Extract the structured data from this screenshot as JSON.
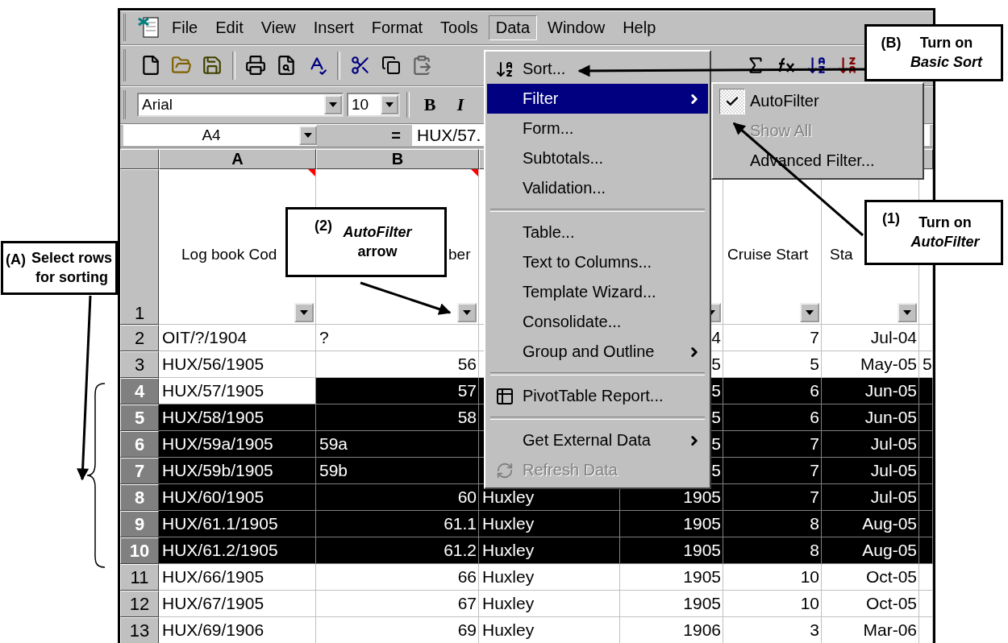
{
  "menubar": {
    "items": [
      {
        "label": "File",
        "selected": false
      },
      {
        "label": "Edit",
        "selected": false
      },
      {
        "label": "View",
        "selected": false
      },
      {
        "label": "Insert",
        "selected": false
      },
      {
        "label": "Format",
        "selected": false
      },
      {
        "label": "Tools",
        "selected": false
      },
      {
        "label": "Data",
        "selected": true
      },
      {
        "label": "Window",
        "selected": false
      },
      {
        "label": "Help",
        "selected": false
      }
    ]
  },
  "formatting_toolbar": {
    "font": "Arial",
    "size": "10",
    "bold_button": "B",
    "italic_button": "I"
  },
  "formula_bar": {
    "name_box": "A4",
    "equals": "=",
    "value": "HUX/57."
  },
  "columns": [
    {
      "label": "A"
    },
    {
      "label": "B"
    },
    {},
    {},
    {},
    {},
    {}
  ],
  "header_row": {
    "number": "1",
    "cells": [
      {
        "text": "Log book Cod",
        "filter": true,
        "comment": true
      },
      {
        "text": "ber",
        "filter": true,
        "comment": true
      },
      {
        "filter": false,
        "comment": false
      },
      {
        "filter": true,
        "comment": false
      },
      {
        "text": "Cruise Start",
        "filter": true,
        "comment": false
      },
      {
        "text": "Sta",
        "filter": true,
        "comment": false
      },
      {
        "filter": false,
        "comment": false
      }
    ]
  },
  "rows": [
    {
      "number": "2",
      "selected": false,
      "cells": [
        {
          "text": "OIT/?/1904",
          "kind": "text",
          "active": false
        },
        {
          "text": "?",
          "kind": "text",
          "active": false
        },
        {
          "active": false
        },
        {
          "text": "4",
          "kind": "number",
          "active": false
        },
        {
          "text": "7",
          "kind": "number",
          "active": false
        },
        {
          "text": "Jul-04",
          "kind": "number",
          "active": false
        },
        {
          "active": false
        }
      ]
    },
    {
      "number": "3",
      "selected": false,
      "cells": [
        {
          "text": "HUX/56/1905",
          "kind": "text",
          "active": false
        },
        {
          "text": "56",
          "kind": "number",
          "active": false
        },
        {
          "active": false
        },
        {
          "text": "5",
          "kind": "number",
          "active": false
        },
        {
          "text": "5",
          "kind": "number",
          "active": false
        },
        {
          "text": "May-05",
          "kind": "number",
          "active": false
        },
        {
          "text": "5",
          "kind": "text",
          "active": false
        }
      ]
    },
    {
      "number": "4",
      "selected": true,
      "cells": [
        {
          "text": "HUX/57/1905",
          "kind": "text",
          "active": true
        },
        {
          "text": "57",
          "kind": "number",
          "active": false
        },
        {
          "active": false
        },
        {
          "text": "5",
          "kind": "number",
          "active": false
        },
        {
          "text": "6",
          "kind": "number",
          "active": false
        },
        {
          "text": "Jun-05",
          "kind": "number",
          "active": false
        },
        {
          "active": false
        }
      ]
    },
    {
      "number": "5",
      "selected": true,
      "cells": [
        {
          "text": "HUX/58/1905",
          "kind": "text",
          "active": false
        },
        {
          "text": "58",
          "kind": "number",
          "active": false
        },
        {
          "active": false
        },
        {
          "text": "5",
          "kind": "number",
          "active": false
        },
        {
          "text": "6",
          "kind": "number",
          "active": false
        },
        {
          "text": "Jun-05",
          "kind": "number",
          "active": false
        },
        {
          "active": false
        }
      ]
    },
    {
      "number": "6",
      "selected": true,
      "cells": [
        {
          "text": "HUX/59a/1905",
          "kind": "text",
          "active": false
        },
        {
          "text": "59a",
          "kind": "text",
          "active": false
        },
        {
          "active": false
        },
        {
          "text": "5",
          "kind": "number",
          "active": false
        },
        {
          "text": "7",
          "kind": "number",
          "active": false
        },
        {
          "text": "Jul-05",
          "kind": "number",
          "active": false
        },
        {
          "active": false
        }
      ]
    },
    {
      "number": "7",
      "selected": true,
      "cells": [
        {
          "text": "HUX/59b/1905",
          "kind": "text",
          "active": false
        },
        {
          "text": "59b",
          "kind": "text",
          "active": false
        },
        {
          "active": false
        },
        {
          "text": "5",
          "kind": "number",
          "active": false
        },
        {
          "text": "7",
          "kind": "number",
          "active": false
        },
        {
          "text": "Jul-05",
          "kind": "number",
          "active": false
        },
        {
          "active": false
        }
      ]
    },
    {
      "number": "8",
      "selected": true,
      "cells": [
        {
          "text": "HUX/60/1905",
          "kind": "text",
          "active": false
        },
        {
          "text": "60",
          "kind": "number",
          "active": false
        },
        {
          "text": "Huxley",
          "kind": "text",
          "active": false
        },
        {
          "text": "1905",
          "kind": "number",
          "active": false
        },
        {
          "text": "7",
          "kind": "number",
          "active": false
        },
        {
          "text": "Jul-05",
          "kind": "number",
          "active": false
        },
        {
          "active": false
        }
      ]
    },
    {
      "number": "9",
      "selected": true,
      "cells": [
        {
          "text": "HUX/61.1/1905",
          "kind": "text",
          "active": false
        },
        {
          "text": "61.1",
          "kind": "number",
          "active": false
        },
        {
          "text": "Huxley",
          "kind": "text",
          "active": false
        },
        {
          "text": "1905",
          "kind": "number",
          "active": false
        },
        {
          "text": "8",
          "kind": "number",
          "active": false
        },
        {
          "text": "Aug-05",
          "kind": "number",
          "active": false
        },
        {
          "active": false
        }
      ]
    },
    {
      "number": "10",
      "selected": true,
      "cells": [
        {
          "text": "HUX/61.2/1905",
          "kind": "text",
          "active": false
        },
        {
          "text": "61.2",
          "kind": "number",
          "active": false
        },
        {
          "text": "Huxley",
          "kind": "text",
          "active": false
        },
        {
          "text": "1905",
          "kind": "number",
          "active": false
        },
        {
          "text": "8",
          "kind": "number",
          "active": false
        },
        {
          "text": "Aug-05",
          "kind": "number",
          "active": false
        },
        {
          "active": false
        }
      ]
    },
    {
      "number": "11",
      "selected": false,
      "cells": [
        {
          "text": "HUX/66/1905",
          "kind": "text",
          "active": false
        },
        {
          "text": "66",
          "kind": "number",
          "active": false
        },
        {
          "text": "Huxley",
          "kind": "text",
          "active": false
        },
        {
          "text": "1905",
          "kind": "number",
          "active": false
        },
        {
          "text": "10",
          "kind": "number",
          "active": false
        },
        {
          "text": "Oct-05",
          "kind": "number",
          "active": false
        },
        {
          "active": false
        }
      ]
    },
    {
      "number": "12",
      "selected": false,
      "cells": [
        {
          "text": "HUX/67/1905",
          "kind": "text",
          "active": false
        },
        {
          "text": "67",
          "kind": "number",
          "active": false
        },
        {
          "text": "Huxley",
          "kind": "text",
          "active": false
        },
        {
          "text": "1905",
          "kind": "number",
          "active": false
        },
        {
          "text": "10",
          "kind": "number",
          "active": false
        },
        {
          "text": "Oct-05",
          "kind": "number",
          "active": false
        },
        {
          "active": false
        }
      ]
    },
    {
      "number": "13",
      "selected": false,
      "cells": [
        {
          "text": "HUX/69/1906",
          "kind": "text",
          "active": false
        },
        {
          "text": "69",
          "kind": "number",
          "active": false
        },
        {
          "text": "Huxley",
          "kind": "text",
          "active": false
        },
        {
          "text": "1906",
          "kind": "number",
          "active": false
        },
        {
          "text": "3",
          "kind": "number",
          "active": false
        },
        {
          "text": "Mar-06",
          "kind": "number",
          "active": false
        },
        {
          "active": false
        }
      ]
    }
  ],
  "data_menu": {
    "items": [
      {
        "kind": "item",
        "label": "Sort...",
        "selected": false,
        "disabled": false,
        "submenu": false
      },
      {
        "kind": "item",
        "label": "Filter",
        "selected": true,
        "disabled": false,
        "submenu": true
      },
      {
        "kind": "item",
        "label": "Form...",
        "selected": false,
        "disabled": false,
        "submenu": false
      },
      {
        "kind": "item",
        "label": "Subtotals...",
        "selected": false,
        "disabled": false,
        "submenu": false
      },
      {
        "kind": "item",
        "label": "Validation...",
        "selected": false,
        "disabled": false,
        "submenu": false
      },
      {
        "kind": "separator"
      },
      {
        "kind": "item",
        "label": "Table...",
        "selected": false,
        "disabled": false,
        "submenu": false
      },
      {
        "kind": "item",
        "label": "Text to Columns...",
        "selected": false,
        "disabled": false,
        "submenu": false
      },
      {
        "kind": "item",
        "label": "Template Wizard...",
        "selected": false,
        "disabled": false,
        "submenu": false
      },
      {
        "kind": "item",
        "label": "Consolidate...",
        "selected": false,
        "disabled": false,
        "submenu": false
      },
      {
        "kind": "item",
        "label": "Group and Outline",
        "selected": false,
        "disabled": false,
        "submenu": true
      },
      {
        "kind": "separator"
      },
      {
        "kind": "item",
        "label": "PivotTable Report...",
        "selected": false,
        "disabled": false,
        "submenu": false
      },
      {
        "kind": "separator"
      },
      {
        "kind": "item",
        "label": "Get External Data",
        "selected": false,
        "disabled": false,
        "submenu": true
      },
      {
        "kind": "item",
        "label": "Refresh Data",
        "selected": false,
        "disabled": true,
        "submenu": false
      }
    ]
  },
  "filter_submenu": {
    "items": [
      {
        "label": "AutoFilter",
        "checked": true,
        "disabled": false
      },
      {
        "label": "Show All",
        "checked": false,
        "disabled": true
      },
      {
        "label": "Advanced Filter...",
        "checked": false,
        "disabled": false
      }
    ]
  },
  "callouts": [
    {
      "kind": "sort",
      "number": "(B)",
      "text": "Turn on *Basic Sort*"
    },
    {
      "kind": "rows",
      "number": "(A)",
      "text": "Select rows for sorting"
    },
    {
      "kind": "arrow",
      "number": "(2)",
      "text": "*AutoFilter* arrow"
    },
    {
      "kind": "autofilter",
      "number": "(1)",
      "text": "Turn on *AutoFilter*"
    }
  ]
}
